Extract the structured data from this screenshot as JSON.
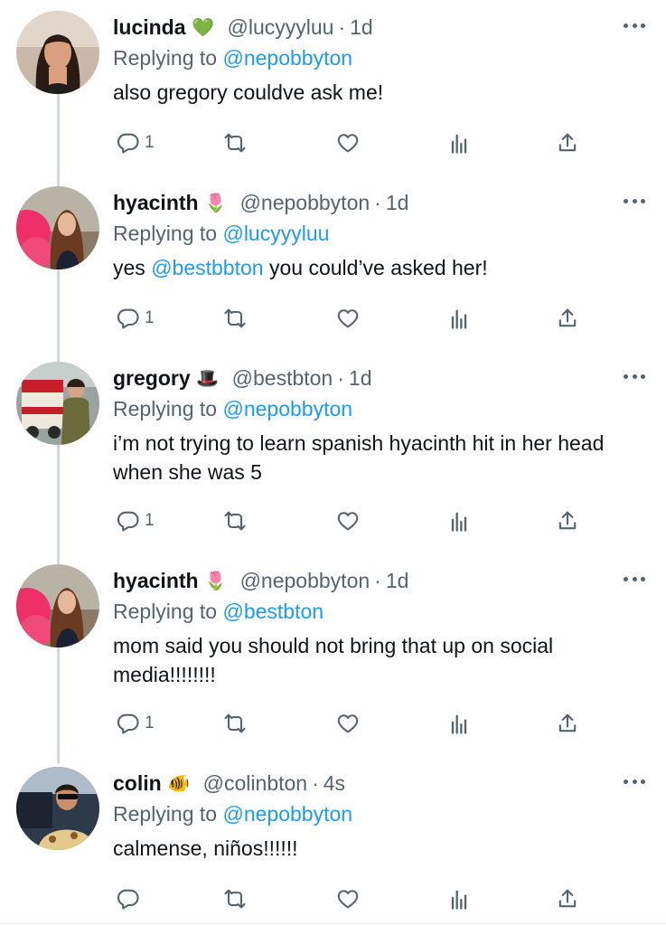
{
  "tweets": [
    {
      "name": "lucinda",
      "emoji": "💚",
      "handle": "@lucyyyluu",
      "sep": "·",
      "time": "1d",
      "reply_prefix": "Replying to",
      "reply_to": "@nepobbyton",
      "text_before": "also gregory couldve ask me!",
      "text_mention": "",
      "text_after": "",
      "reply_count": "1",
      "avatar_icon": "user-avatar-lucinda"
    },
    {
      "name": "hyacinth",
      "emoji": "🌷",
      "handle": "@nepobbyton",
      "sep": "·",
      "time": "1d",
      "reply_prefix": "Replying to",
      "reply_to": "@lucyyyluu",
      "text_before": "yes ",
      "text_mention": "@bestbbton",
      "text_after": " you could’ve asked her!",
      "reply_count": "1",
      "avatar_icon": "user-avatar-hyacinth"
    },
    {
      "name": "gregory",
      "emoji": "🎩",
      "handle": "@bestbton",
      "sep": "·",
      "time": "1d",
      "reply_prefix": "Replying to",
      "reply_to": "@nepobbyton",
      "text_before": "i’m not trying to learn spanish hyacinth hit in her head when she was 5",
      "text_mention": "",
      "text_after": "",
      "reply_count": "1",
      "avatar_icon": "user-avatar-gregory"
    },
    {
      "name": "hyacinth",
      "emoji": "🌷",
      "handle": "@nepobbyton",
      "sep": "·",
      "time": "1d",
      "reply_prefix": "Replying to",
      "reply_to": "@bestbton",
      "text_before": "mom said you should not bring that up on social media!!!!!!!!",
      "text_mention": "",
      "text_after": "",
      "reply_count": "1",
      "avatar_icon": "user-avatar-hyacinth"
    },
    {
      "name": "colin",
      "emoji": "🐠",
      "handle": "@colinbton",
      "sep": "·",
      "time": "4s",
      "reply_prefix": "Replying to",
      "reply_to": "@nepobbyton",
      "text_before": "calmense, niños!!!!!!",
      "text_mention": "",
      "text_after": "",
      "reply_count": "",
      "avatar_icon": "user-avatar-colin"
    }
  ],
  "icons": {
    "reply": "reply-icon",
    "retweet": "retweet-icon",
    "like": "like-icon",
    "views": "views-icon",
    "share": "share-icon",
    "more": "more-icon"
  },
  "colors": {
    "accent": "#1d9bf0",
    "muted": "#536471",
    "text": "#0f1419",
    "thread_line": "#cfd9de"
  }
}
